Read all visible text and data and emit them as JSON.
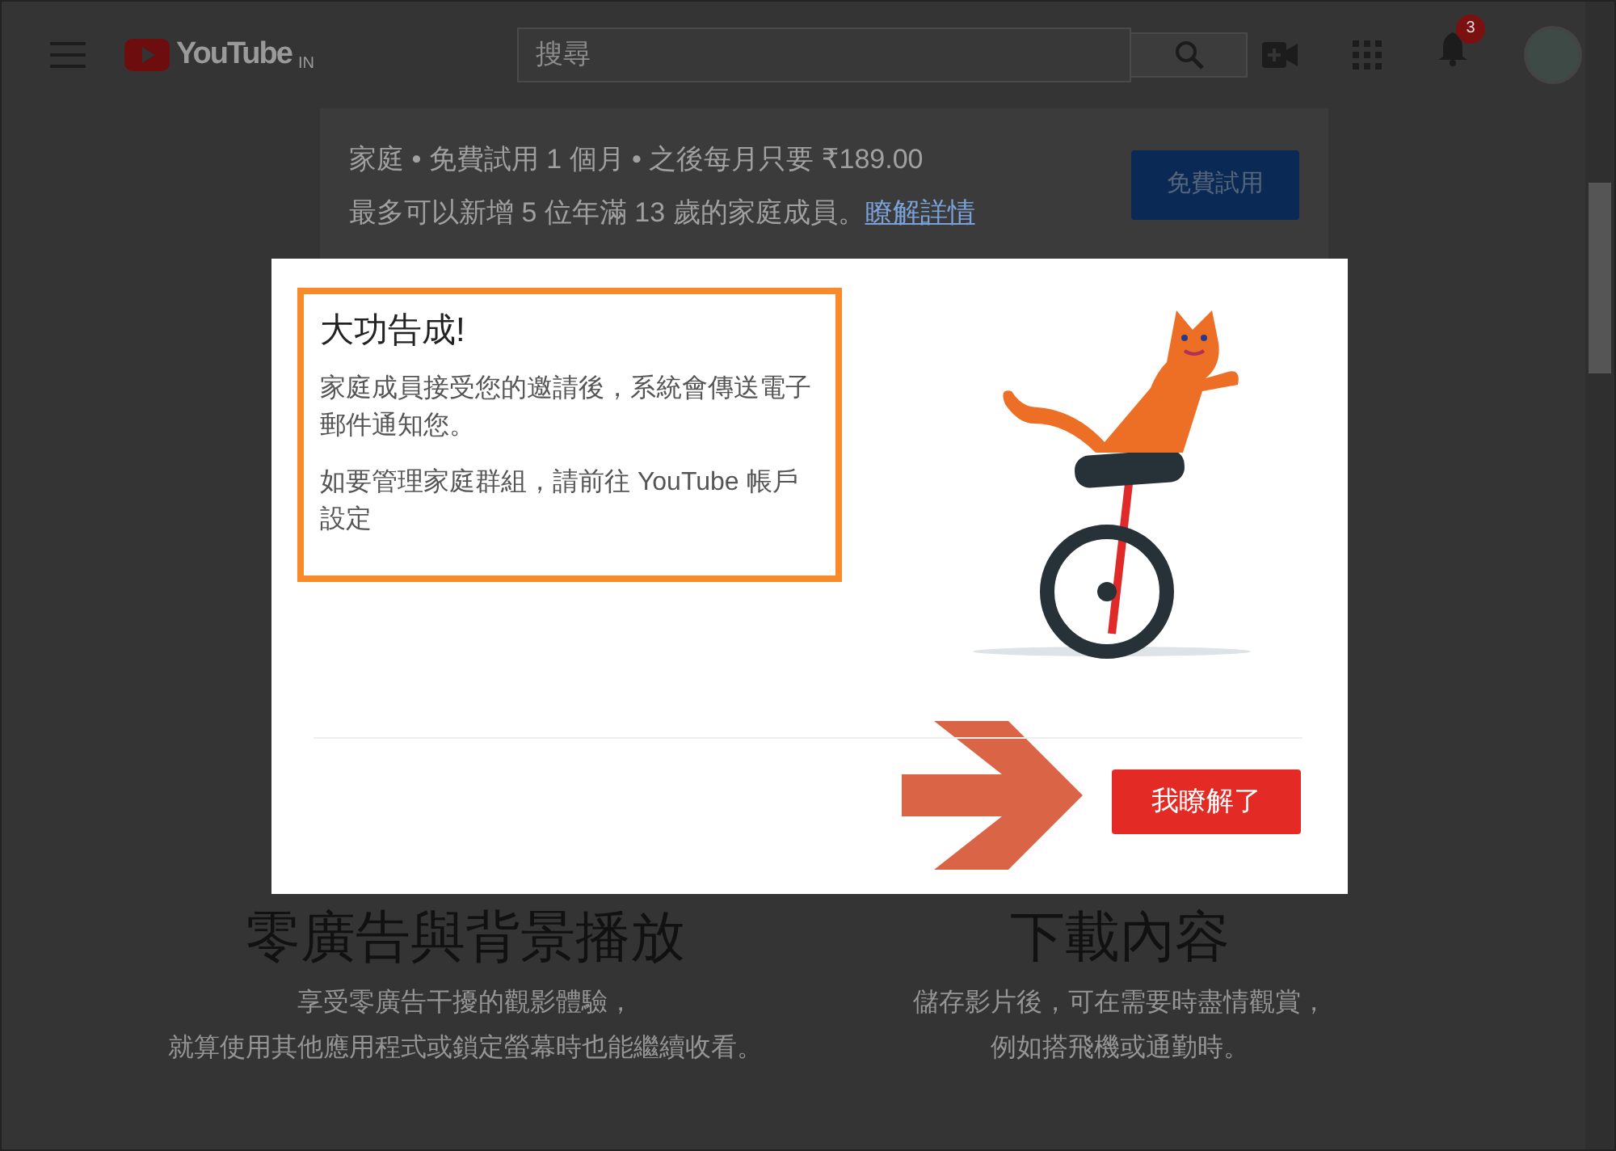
{
  "header": {
    "logo": "YouTube",
    "region": "IN",
    "search": {
      "placeholder": "搜尋"
    },
    "notification_count": "3"
  },
  "banner": {
    "line1": "家庭 • 免費試用 1 個月 • 之後每月只要 ₹189.00",
    "line2": "最多可以新增 5 位年滿 13 歲的家庭成員。",
    "link": "瞭解詳情",
    "button": "免費試用"
  },
  "dialog": {
    "title": "大功告成!",
    "paragraphs": [
      "家庭成員接受您的邀請後，系統會傳送電子郵件通知您。",
      "如要管理家庭群組，請前往 YouTube 帳戶設定"
    ],
    "button": "我瞭解了"
  },
  "annotations": {
    "highlight_frame": true,
    "arrow": true
  },
  "features": [
    {
      "title": "零廣告與背景播放",
      "lines": [
        "享受零廣告干擾的觀影體驗，",
        "就算使用其他應用程式或鎖定螢幕時也能繼續收看。"
      ]
    },
    {
      "title": "下載內容",
      "lines": [
        "儲存影片後，可在需要時盡情觀賞，",
        "例如搭飛機或通勤時。"
      ]
    }
  ]
}
